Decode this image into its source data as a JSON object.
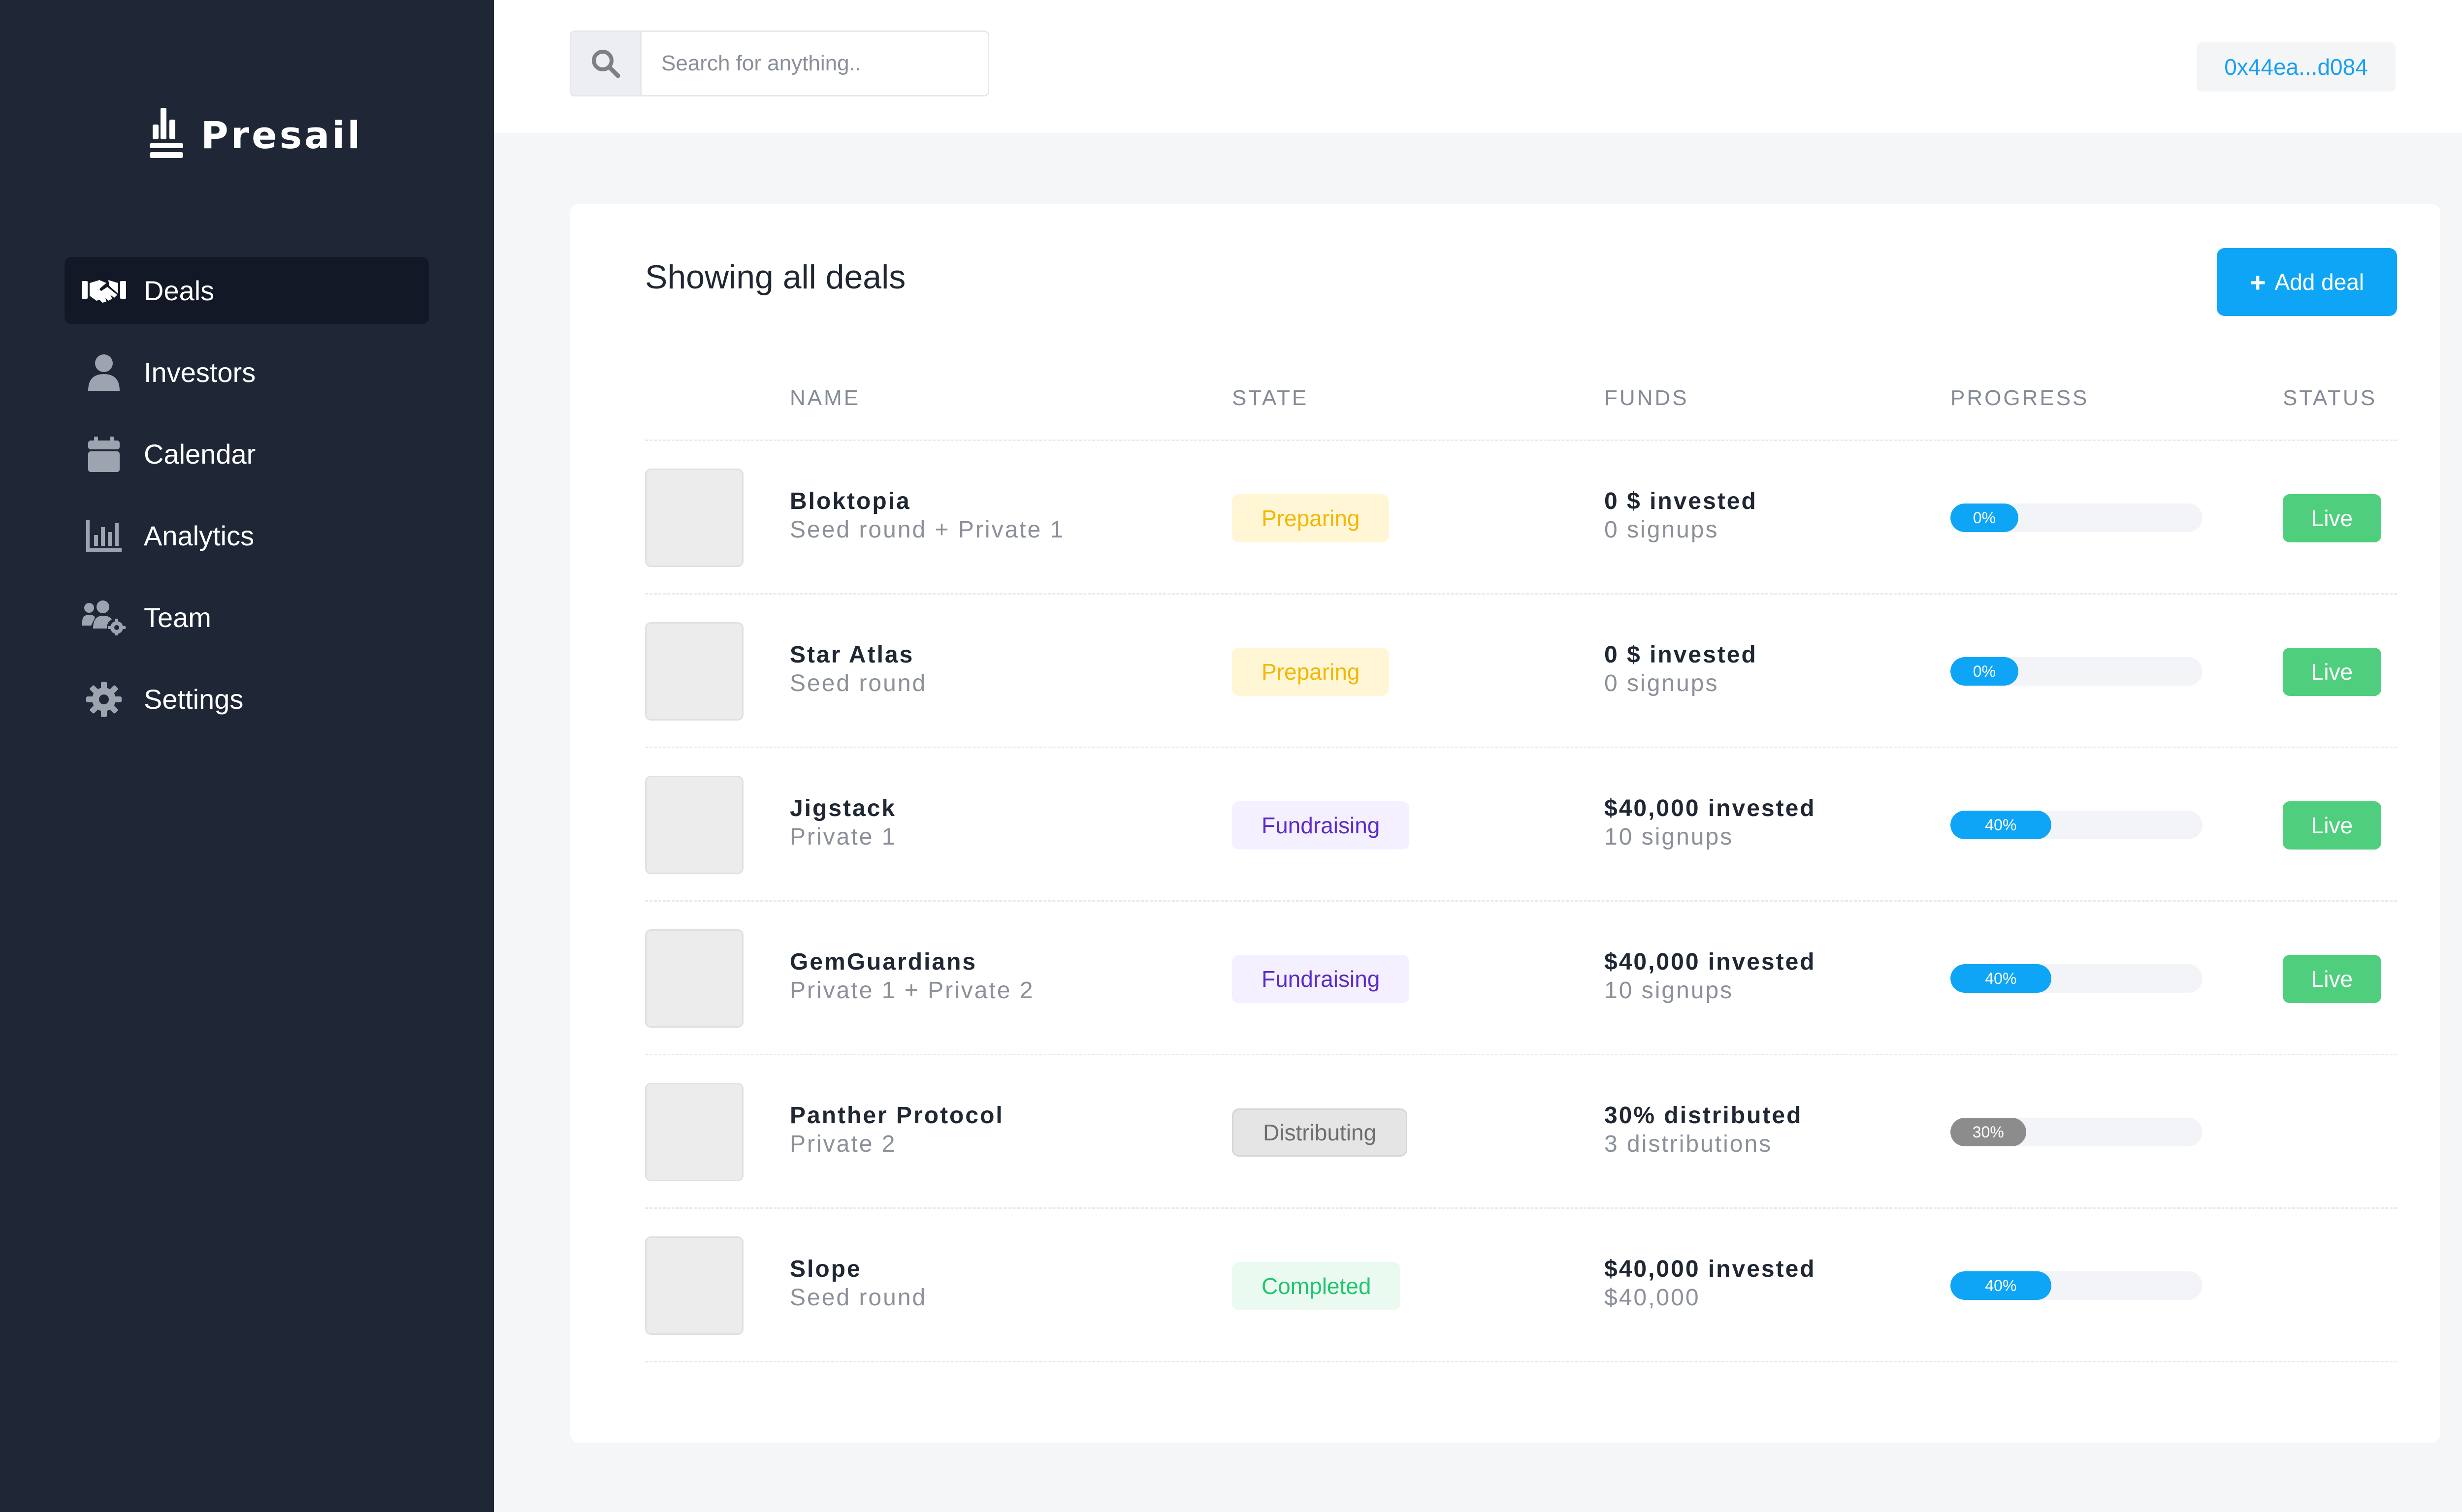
{
  "app": {
    "name": "Presail"
  },
  "sidebar": {
    "items": [
      {
        "label": "Deals",
        "icon": "handshake-icon",
        "active": true
      },
      {
        "label": "Investors",
        "icon": "user-icon",
        "active": false
      },
      {
        "label": "Calendar",
        "icon": "calendar-icon",
        "active": false
      },
      {
        "label": "Analytics",
        "icon": "bar-chart-icon",
        "active": false
      },
      {
        "label": "Team",
        "icon": "users-gear-icon",
        "active": false
      },
      {
        "label": "Settings",
        "icon": "gear-icon",
        "active": false
      }
    ]
  },
  "topbar": {
    "search_placeholder": "Search for anything..",
    "search_value": "",
    "wallet": "0x44ea...d084"
  },
  "deals": {
    "title": "Showing all deals",
    "add_button": "Add deal",
    "add_icon": "+",
    "columns": [
      "NAME",
      "STATE",
      "FUNDS",
      "PROGRESS",
      "STATUS"
    ],
    "rows": [
      {
        "name": "Bloktopia",
        "round": "Seed round + Private 1",
        "state": "Preparing",
        "state_kind": "preparing",
        "funds_main": "0 $ invested",
        "funds_sub": "0 signups",
        "progress": 0,
        "progress_label": "0%",
        "progress_color": "blue",
        "status": "Live"
      },
      {
        "name": "Star Atlas",
        "round": "Seed round",
        "state": "Preparing",
        "state_kind": "preparing",
        "funds_main": "0 $ invested",
        "funds_sub": "0 signups",
        "progress": 0,
        "progress_label": "0%",
        "progress_color": "blue",
        "status": "Live"
      },
      {
        "name": "Jigstack",
        "round": "Private 1",
        "state": "Fundraising",
        "state_kind": "fundraising",
        "funds_main": "$40,000 invested",
        "funds_sub": "10 signups",
        "progress": 40,
        "progress_label": "40%",
        "progress_color": "blue",
        "status": "Live"
      },
      {
        "name": "GemGuardians",
        "round": "Private 1 + Private 2",
        "state": "Fundraising",
        "state_kind": "fundraising",
        "funds_main": "$40,000 invested",
        "funds_sub": "10 signups",
        "progress": 40,
        "progress_label": "40%",
        "progress_color": "blue",
        "status": "Live"
      },
      {
        "name": "Panther Protocol",
        "round": "Private 2",
        "state": "Distributing",
        "state_kind": "distributing",
        "funds_main": "30% distributed",
        "funds_sub": "3 distributions",
        "progress": 30,
        "progress_label": "30%",
        "progress_color": "grey",
        "status": ""
      },
      {
        "name": "Slope",
        "round": "Seed round",
        "state": "Completed",
        "state_kind": "completed",
        "funds_main": "$40,000 invested",
        "funds_sub": "$40,000",
        "progress": 40,
        "progress_label": "40%",
        "progress_color": "blue",
        "status": ""
      }
    ]
  },
  "colors": {
    "sidebar_bg": "#1f2737",
    "accent": "#0ea5f7",
    "live": "#4fcf7e"
  }
}
